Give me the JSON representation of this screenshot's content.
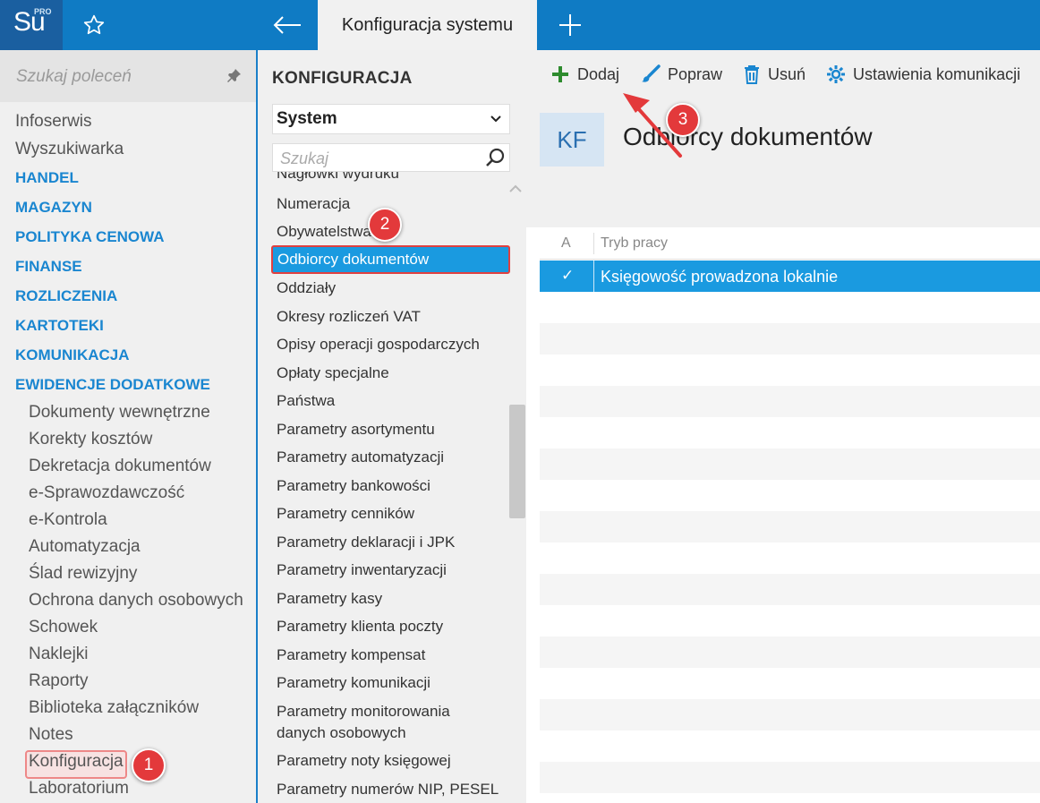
{
  "topbar": {
    "logo_text": "Su",
    "logo_badge": "PRO",
    "tab_title": "Konfiguracja systemu"
  },
  "sidebar": {
    "search_placeholder": "Szukaj poleceń",
    "top_items": [
      "Infoserwis",
      "Wyszukiwarka"
    ],
    "sections": [
      "HANDEL",
      "MAGAZYN",
      "POLITYKA CENOWA",
      "FINANSE",
      "ROZLICZENIA",
      "KARTOTEKI",
      "KOMUNIKACJA",
      "EWIDENCJE DODATKOWE"
    ],
    "subitems": [
      "Dokumenty wewnętrzne",
      "Korekty kosztów",
      "Dekretacja dokumentów",
      "e-Sprawozdawczość",
      "e-Kontrola",
      "Automatyzacja",
      "Ślad rewizyjny",
      "Ochrona danych osobowych",
      "Schowek",
      "Naklejki",
      "Raporty",
      "Biblioteka załączników",
      "Notes",
      "Konfiguracja",
      "Laboratorium"
    ]
  },
  "config": {
    "title": "KONFIGURACJA",
    "select_value": "System",
    "search_placeholder": "Szukaj",
    "partial_item": "Nagłówki wydruku",
    "items": [
      "Numeracja",
      "Obywatelstwa",
      "Odbiorcy dokumentów",
      "Oddziały",
      "Okresy rozliczeń VAT",
      "Opisy operacji gospodarczych",
      "Opłaty specjalne",
      "Państwa",
      "Parametry asortymentu",
      "Parametry automatyzacji",
      "Parametry bankowości",
      "Parametry cenników",
      "Parametry deklaracji i JPK",
      "Parametry inwentaryzacji",
      "Parametry kasy",
      "Parametry klienta poczty",
      "Parametry kompensat",
      "Parametry komunikacji",
      "Parametry monitorowania danych osobowych",
      "Parametry noty księgowej",
      "Parametry numerów NIP, PESEL"
    ],
    "selected_index": 2
  },
  "main": {
    "toolbar": {
      "add": "Dodaj",
      "edit": "Popraw",
      "delete": "Usuń",
      "settings": "Ustawienia komunikacji"
    },
    "badge": "KF",
    "title": "Odbiorcy dokumentów",
    "grid": {
      "col_a": "A",
      "col_mode": "Tryb pracy",
      "rows": [
        {
          "check": "✓",
          "mode": "Księgowość prowadzona lokalnie"
        }
      ]
    }
  },
  "annotations": [
    "1",
    "2",
    "3"
  ],
  "colors": {
    "topbar": "#0f7bc4",
    "accent": "#1a9ae0",
    "section": "#1a86d0",
    "annotation": "#e3393b",
    "add_icon": "#2e8b2e"
  }
}
